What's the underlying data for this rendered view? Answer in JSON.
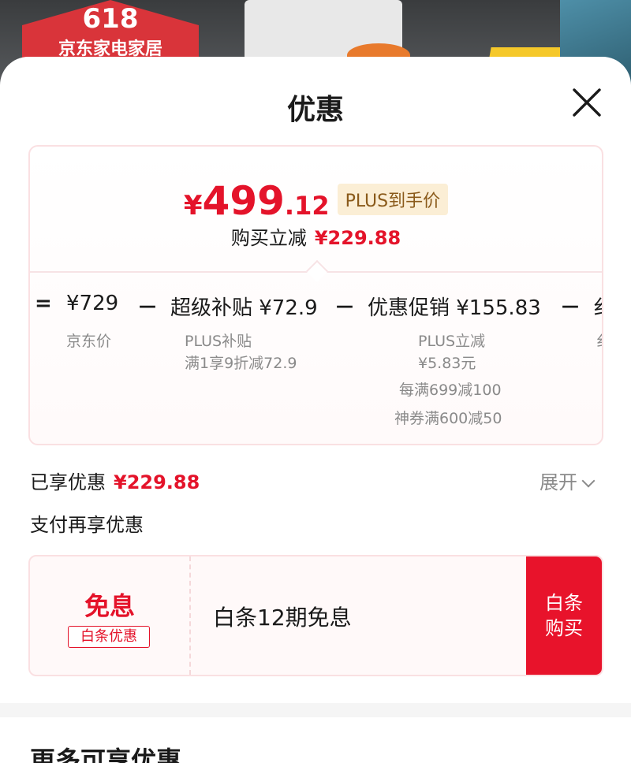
{
  "background": {
    "badge_number": "618",
    "badge_text": "京东家电家居"
  },
  "sheet": {
    "title": "优惠"
  },
  "price_card": {
    "currency": "¥",
    "final_price_int": "499",
    "final_price_dec": ".12",
    "plus_tag": "PLUS到手价",
    "reduce_label": "购买立减",
    "reduce_amount": "¥229.88",
    "formula": {
      "equals": "=",
      "jd_price": "¥729",
      "minus1": "－",
      "subsidy": "超级补贴 ¥72.9",
      "minus2": "－",
      "promo": "优惠促销 ¥155.83",
      "minus3": "－",
      "cut": "纟"
    },
    "notes": {
      "jd_price_label": "京东价",
      "subsidy_l1": "PLUS补贴",
      "subsidy_l2": "满1享9折减72.9",
      "promo_l1": "PLUS立减",
      "promo_l2": "¥5.83元",
      "promo_l3": "每满699减100",
      "promo_l4": "神券满600减50",
      "cut": "纟"
    }
  },
  "enjoyed": {
    "label": "已享优惠",
    "amount": "¥229.88",
    "expand": "展开"
  },
  "pay_more": "支付再享优惠",
  "baitiao": {
    "big": "免息",
    "tag": "白条优惠",
    "desc": "白条12期免息",
    "btn_l1": "白条",
    "btn_l2": "购买"
  },
  "more_title": "更多可享优惠",
  "colors": {
    "accent_red": "#e4132a",
    "button_red": "#e8132b",
    "plus_tag_bg": "#fbeed5"
  }
}
